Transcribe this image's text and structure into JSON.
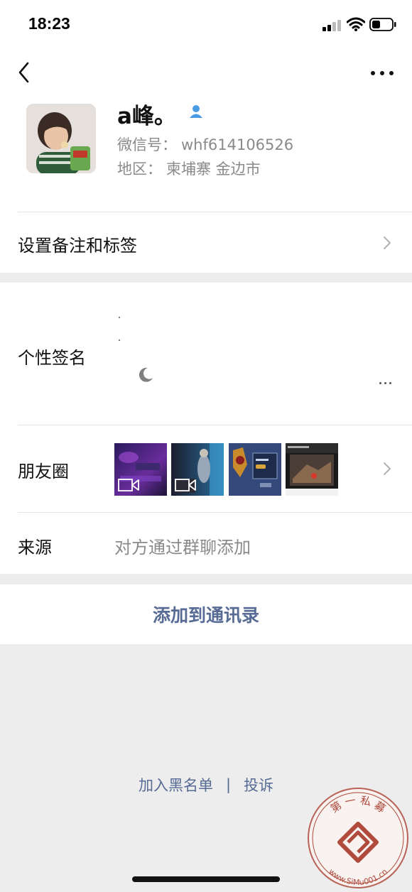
{
  "status_bar": {
    "time": "18:23",
    "icons": [
      "cellular-signal-icon",
      "wifi-icon",
      "battery-icon"
    ]
  },
  "nav": {
    "back_icon": "chevron-left-icon",
    "more_icon": "more-dots-icon"
  },
  "profile": {
    "nickname": "a峰。",
    "friend_icon": "person-icon",
    "wechat_id_label": "微信号：",
    "wechat_id": "whf614106526",
    "region_label": "地区：",
    "region": "柬埔寨 金边市"
  },
  "remark_row": {
    "label": "设置备注和标签"
  },
  "signature_row": {
    "label": "个性签名",
    "emoji_icon": "crescent-moon-icon"
  },
  "moments_row": {
    "label": "朋友圈",
    "thumbnails": [
      {
        "kind": "video",
        "icon": "video-camera-icon"
      },
      {
        "kind": "video",
        "icon": "video-camera-icon"
      },
      {
        "kind": "image"
      },
      {
        "kind": "image"
      }
    ]
  },
  "source_row": {
    "label": "来源",
    "value": "对方通过群聊添加"
  },
  "actions": {
    "add_contact": "添加到通讯录"
  },
  "footer": {
    "blacklist": "加入黑名单",
    "separator": "|",
    "report": "投诉"
  },
  "watermark": {
    "top_text": "第 一 私 募",
    "bottom_text": "www.SiMu001.cn"
  },
  "colors": {
    "link": "#576b95",
    "background": "#ededed",
    "card": "#ffffff",
    "secondary_text": "#8a8a8a",
    "watermark": "#b04a3c"
  }
}
